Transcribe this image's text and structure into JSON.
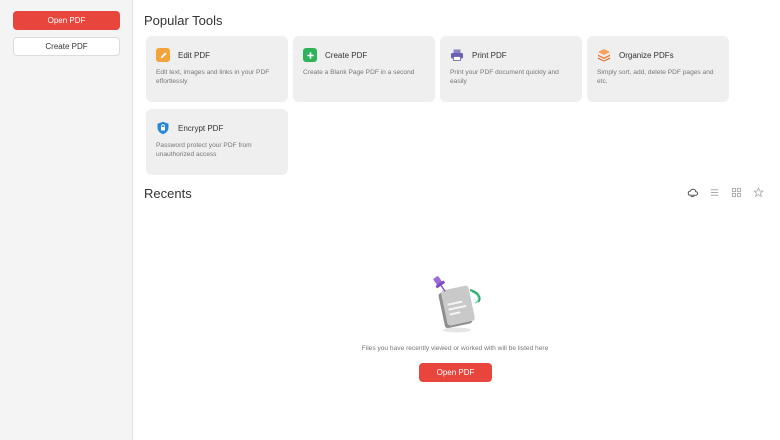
{
  "sidebar": {
    "open_pdf_label": "Open PDF",
    "create_pdf_label": "Create PDF"
  },
  "popular_tools": {
    "title": "Popular Tools",
    "tools": [
      {
        "name": "Edit PDF",
        "desc": "Edit text, images and links in your PDF effortlessly",
        "icon": "pencil-icon",
        "color": "#f2a33a"
      },
      {
        "name": "Create PDF",
        "desc": "Create a Blank Page PDF in a second",
        "icon": "plus-icon",
        "color": "#2fb35a"
      },
      {
        "name": "Print PDF",
        "desc": "Print your PDF document quickly and easily",
        "icon": "printer-icon",
        "color": "#6a5fb0"
      },
      {
        "name": "Organize PDFs",
        "desc": "Simply sort, add, delete PDF pages and etc.",
        "icon": "layers-icon",
        "color": "#f07a2e"
      },
      {
        "name": "Encrypt PDF",
        "desc": "Password protect your PDF from unauthorized access",
        "icon": "shield-icon",
        "color": "#2a86d8"
      }
    ]
  },
  "recents": {
    "title": "Recents",
    "empty_text": "Files you have recently viewed or worked with will be listed here",
    "open_pdf_label": "Open PDF",
    "view_icons": [
      "cloud-icon",
      "list-view-icon",
      "grid-view-icon",
      "star-icon"
    ]
  },
  "colors": {
    "accent": "#e8453c",
    "sidebar_bg": "#f4f4f4",
    "card_bg": "#efefef"
  }
}
